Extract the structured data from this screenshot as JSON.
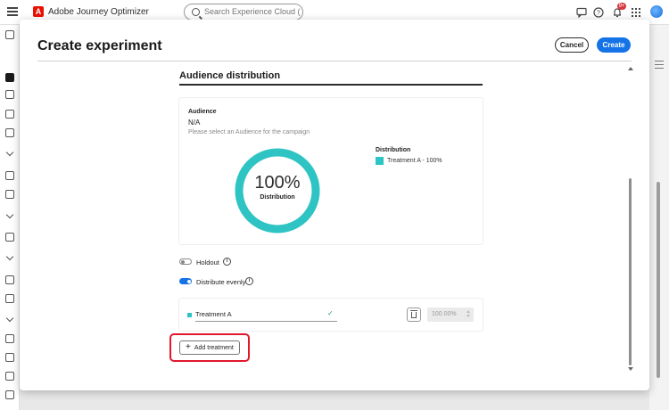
{
  "app": {
    "name": "Adobe Journey Optimizer",
    "logo_letter": "A"
  },
  "search": {
    "placeholder": "Search Experience Cloud (Ctrl+/)"
  },
  "notifications": {
    "count": "9+"
  },
  "modal": {
    "title": "Create experiment",
    "cancel_label": "Cancel",
    "create_label": "Create"
  },
  "audience_distribution": {
    "section_title": "Audience distribution",
    "audience_label": "Audience",
    "audience_value": "N/A",
    "audience_hint": "Please select an Audience for the campaign",
    "donut_value": "100%",
    "donut_caption": "Distribution",
    "distribution_label": "Distribution",
    "legend": [
      {
        "label": "Treatment A - 100%",
        "color": "#2ec4c4",
        "share": 100
      }
    ]
  },
  "toggles": {
    "holdout": {
      "label": "Holdout",
      "on": false
    },
    "distribute_evenly": {
      "label": "Distribute evenly",
      "on": true
    }
  },
  "treatments": [
    {
      "name": "Treatment A",
      "percent": "100.00%",
      "color": "#2ec4c4"
    }
  ],
  "add_treatment_label": "Add treatment",
  "colors": {
    "accent": "#1473e6",
    "treatment": "#2ec4c4",
    "highlight": "#e0182c"
  },
  "icons": {
    "info": "i",
    "check": "✓",
    "plus": "+"
  }
}
